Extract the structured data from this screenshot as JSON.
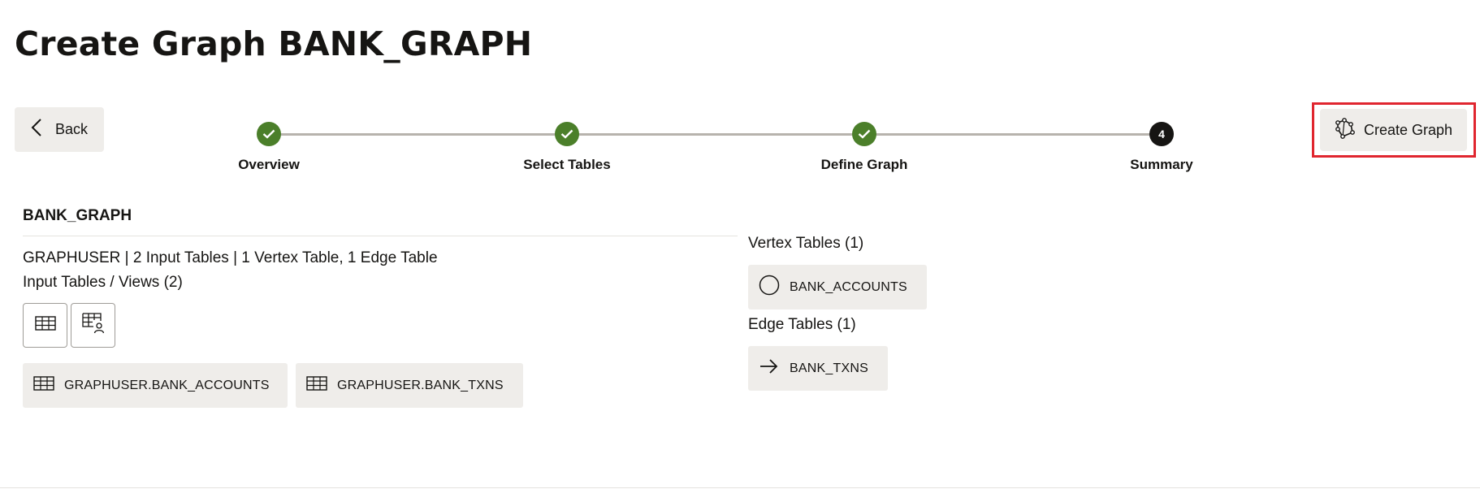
{
  "page": {
    "title": "Create Graph BANK_GRAPH"
  },
  "toolbar": {
    "back_label": "Back",
    "create_label": "Create Graph"
  },
  "stepper": {
    "steps": [
      {
        "label": "Overview",
        "state": "done"
      },
      {
        "label": "Select Tables",
        "state": "done"
      },
      {
        "label": "Define Graph",
        "state": "done"
      },
      {
        "label": "Summary",
        "state": "current",
        "number": "4"
      }
    ]
  },
  "summary": {
    "graph_name": "BANK_GRAPH",
    "details": "GRAPHUSER | 2 Input Tables | 1 Vertex Table, 1 Edge Table",
    "input_tables_title": "Input Tables / Views (2)",
    "input_tables": [
      "GRAPHUSER.BANK_ACCOUNTS",
      "GRAPHUSER.BANK_TXNS"
    ],
    "vertex_title": "Vertex Tables (1)",
    "vertex_tables": [
      "BANK_ACCOUNTS"
    ],
    "edge_title": "Edge Tables (1)",
    "edge_tables": [
      "BANK_TXNS"
    ]
  },
  "colors": {
    "step_done": "#4b7f2a",
    "step_current": "#161513",
    "highlight_border": "#e0262f",
    "chip_bg": "#efedea"
  },
  "icons": {
    "back": "chevron-left-icon",
    "create": "graph-icon",
    "step_done": "check-icon",
    "table": "table-icon",
    "table_user": "table-user-icon",
    "vertex": "circle-icon",
    "edge": "arrow-right-icon"
  }
}
